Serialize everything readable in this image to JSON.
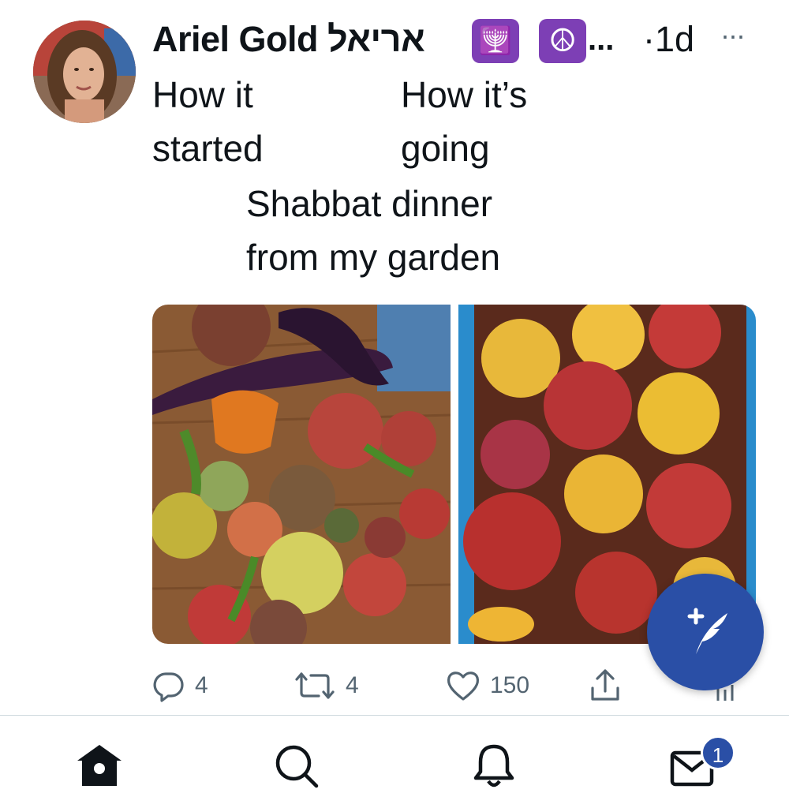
{
  "post": {
    "author_name": "Ariel Gold אריאל",
    "author_emoji_1": "🕎",
    "author_emoji_2": "☮",
    "name_truncation": "...",
    "time": "·1d",
    "more": "···",
    "text_col1_line1": "How it",
    "text_col1_line2": "started",
    "text_col2_line1": "How it’s",
    "text_col2_line2": "going",
    "caption_line1": "Shabbat dinner",
    "caption_line2": "from my garden",
    "photos": [
      "vegetables-harvest-photo",
      "roasted-vegetable-dish-photo"
    ]
  },
  "actions": {
    "reply_count": "4",
    "retweet_count": "4",
    "like_count": "150"
  },
  "fab": {
    "icon": "compose-plus-feather-icon"
  },
  "nav": {
    "items": [
      "home-icon",
      "search-icon",
      "notifications-icon",
      "messages-icon"
    ],
    "messages_badge": "1"
  },
  "colors": {
    "accent": "#2a4fa6",
    "secondary_text": "#536471",
    "emoji_purple": "#7d3fb5"
  }
}
